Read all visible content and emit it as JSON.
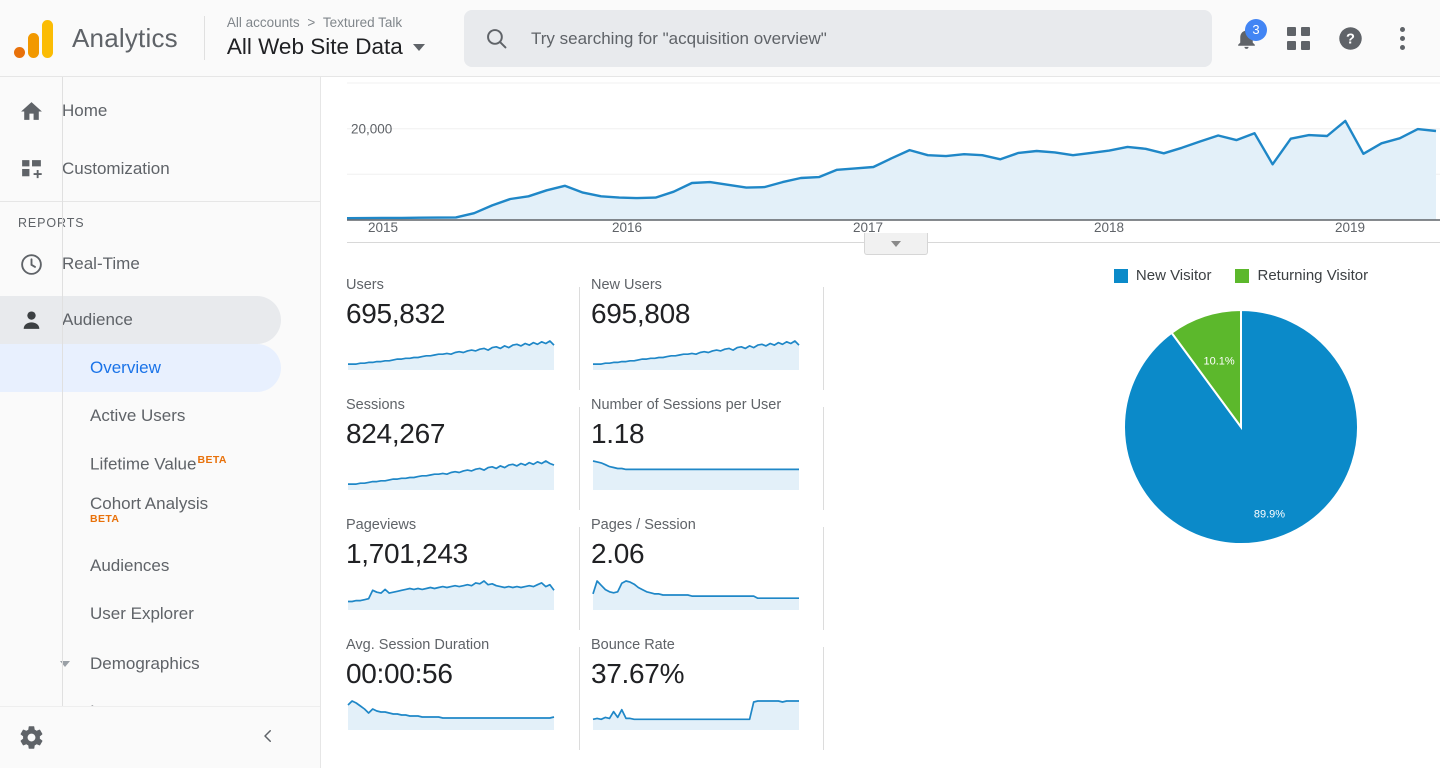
{
  "header": {
    "brand": "Analytics",
    "breadcrumb_all_accounts": "All accounts",
    "breadcrumb_sep": ">",
    "breadcrumb_account": "Textured Talk",
    "property_title": "All Web Site Data",
    "search_placeholder": "Try searching for \"acquisition overview\"",
    "search_value": "",
    "notification_count": "3",
    "icons": {
      "search": "search-icon",
      "notifications": "bell-icon",
      "apps": "apps-grid-icon",
      "help": "help-icon",
      "more": "kebab-menu-icon"
    }
  },
  "sidebar": {
    "top_items": [
      {
        "label": "Home",
        "icon": "home-icon"
      },
      {
        "label": "Customization",
        "icon": "customization-icon"
      }
    ],
    "section_label": "REPORTS",
    "reports": [
      {
        "label": "Real-Time",
        "icon": "clock-icon",
        "state": "normal"
      },
      {
        "label": "Audience",
        "icon": "person-icon",
        "state": "active-parent"
      }
    ],
    "audience_children": [
      {
        "label": "Overview",
        "state": "active-child",
        "beta": ""
      },
      {
        "label": "Active Users",
        "state": "normal",
        "beta": ""
      },
      {
        "label": "Lifetime Value",
        "state": "normal",
        "beta": "BETA",
        "beta_pos": "sup"
      },
      {
        "label": "Cohort Analysis",
        "state": "normal",
        "beta": "BETA",
        "beta_pos": "below"
      },
      {
        "label": "Audiences",
        "state": "normal",
        "beta": ""
      },
      {
        "label": "User Explorer",
        "state": "normal",
        "beta": ""
      }
    ],
    "expandables": [
      {
        "label": "Demographics"
      },
      {
        "label": "Interests"
      }
    ],
    "footer": {
      "settings_icon": "gear-icon",
      "collapse_icon": "chevron-left-icon"
    }
  },
  "main": {
    "metrics": [
      [
        {
          "label": "Users",
          "value": "695,832"
        },
        {
          "label": "New Users",
          "value": "695,808"
        }
      ],
      [
        {
          "label": "Sessions",
          "value": "824,267"
        },
        {
          "label": "Number of Sessions per User",
          "value": "1.18"
        }
      ],
      [
        {
          "label": "Pageviews",
          "value": "1,701,243"
        },
        {
          "label": "Pages / Session",
          "value": "2.06"
        }
      ],
      [
        {
          "label": "Avg. Session Duration",
          "value": "00:00:56"
        },
        {
          "label": "Bounce Rate",
          "value": "37.67%"
        }
      ]
    ]
  },
  "chart_data": [
    {
      "type": "area",
      "name": "sessions-over-time",
      "title": "",
      "xlabel": "",
      "ylabel": "",
      "grid": true,
      "ytick_labels": [
        "20,000"
      ],
      "ytick_values": [
        20000
      ],
      "ylim": [
        0,
        30000
      ],
      "xtick_labels": [
        "2015",
        "2016",
        "2017",
        "2018",
        "2019"
      ],
      "line_color": "#1f87c7",
      "fill_color": "#e3f0f9",
      "x": [
        0,
        1,
        2,
        3,
        4,
        5,
        6,
        7,
        8,
        9,
        10,
        11,
        12,
        13,
        14,
        15,
        16,
        17,
        18,
        19,
        20,
        21,
        22,
        23,
        24,
        25,
        26,
        27,
        28,
        29,
        30,
        31,
        32,
        33,
        34,
        35,
        36,
        37,
        38,
        39,
        40,
        41,
        42,
        43,
        44,
        45,
        46,
        47,
        48,
        49,
        50,
        51,
        52,
        53,
        54,
        55,
        56,
        57,
        58,
        59,
        60
      ],
      "values": [
        400,
        420,
        450,
        470,
        500,
        520,
        560,
        1500,
        3200,
        4600,
        5200,
        6500,
        7500,
        6000,
        5200,
        4900,
        4800,
        4900,
        6200,
        8100,
        8300,
        7700,
        7100,
        7200,
        8300,
        9200,
        9400,
        11000,
        11300,
        11600,
        13500,
        15300,
        14200,
        14000,
        14400,
        14200,
        13300,
        14700,
        15100,
        14800,
        14200,
        14700,
        15200,
        16000,
        15600,
        14600,
        15800,
        17200,
        18500,
        17500,
        19000,
        12200,
        17800,
        18600,
        18400,
        21700,
        14500,
        16800,
        17900,
        19900,
        19500
      ]
    },
    {
      "type": "pie",
      "name": "new-vs-returning-visitor",
      "title": "",
      "legend_position": "top",
      "labels": [
        "New Visitor",
        "Returning Visitor"
      ],
      "values": [
        89.9,
        10.1
      ],
      "value_labels": [
        "89.9%",
        "10.1%"
      ],
      "colors": [
        "#0b8ac9",
        "#5cb82c"
      ]
    },
    {
      "type": "line",
      "name": "sparkline-users",
      "values": [
        6,
        6,
        6,
        7,
        7,
        8,
        8,
        9,
        9,
        10,
        10,
        11,
        12,
        12,
        13,
        13,
        14,
        14,
        15,
        16,
        16,
        17,
        18,
        18,
        19,
        18,
        20,
        21,
        20,
        22,
        23,
        22,
        24,
        25,
        23,
        26,
        27,
        25,
        28,
        26,
        29,
        30,
        28,
        31,
        29,
        32,
        30,
        33,
        31,
        34,
        29
      ]
    },
    {
      "type": "line",
      "name": "sparkline-new-users",
      "values": [
        6,
        6,
        6,
        7,
        7,
        8,
        8,
        9,
        9,
        10,
        10,
        11,
        12,
        12,
        13,
        13,
        14,
        14,
        15,
        16,
        16,
        17,
        18,
        18,
        19,
        18,
        20,
        21,
        20,
        22,
        23,
        22,
        24,
        25,
        23,
        26,
        27,
        25,
        28,
        26,
        29,
        30,
        28,
        31,
        29,
        32,
        30,
        33,
        31,
        34,
        29
      ]
    },
    {
      "type": "line",
      "name": "sparkline-sessions",
      "values": [
        6,
        6,
        6,
        7,
        7,
        8,
        9,
        9,
        10,
        10,
        11,
        12,
        12,
        13,
        13,
        14,
        14,
        15,
        16,
        16,
        17,
        18,
        18,
        19,
        18,
        20,
        21,
        20,
        22,
        23,
        22,
        24,
        25,
        23,
        26,
        27,
        25,
        28,
        26,
        29,
        30,
        28,
        31,
        29,
        32,
        30,
        33,
        31,
        34,
        31,
        29
      ]
    },
    {
      "type": "line",
      "name": "sparkline-sessions-per-user",
      "values": [
        30,
        29,
        28,
        26,
        24,
        23,
        22,
        22,
        21,
        21,
        21,
        21,
        21,
        21,
        21,
        21,
        21,
        21,
        21,
        21,
        21,
        21,
        21,
        21,
        21,
        21,
        21,
        21,
        21,
        21,
        21,
        21,
        21,
        21,
        21,
        21,
        21,
        21,
        21,
        21,
        21,
        21,
        21,
        21,
        21,
        21,
        21,
        21,
        21,
        21,
        21
      ]
    },
    {
      "type": "line",
      "name": "sparkline-pageviews",
      "values": [
        8,
        8,
        9,
        9,
        10,
        11,
        20,
        18,
        17,
        21,
        17,
        18,
        19,
        20,
        21,
        22,
        21,
        22,
        21,
        22,
        23,
        22,
        23,
        24,
        23,
        24,
        25,
        24,
        25,
        26,
        25,
        28,
        27,
        30,
        26,
        27,
        25,
        24,
        23,
        24,
        23,
        24,
        23,
        24,
        25,
        24,
        26,
        28,
        24,
        26,
        20
      ]
    },
    {
      "type": "line",
      "name": "sparkline-pages-per-session",
      "values": [
        14,
        26,
        22,
        18,
        16,
        15,
        16,
        24,
        26,
        25,
        23,
        20,
        18,
        16,
        15,
        14,
        14,
        13,
        13,
        13,
        13,
        13,
        13,
        13,
        12,
        12,
        12,
        12,
        12,
        12,
        12,
        12,
        12,
        12,
        12,
        12,
        12,
        12,
        12,
        12,
        10,
        10,
        10,
        10,
        10,
        10,
        10,
        10,
        10,
        10,
        10
      ]
    },
    {
      "type": "line",
      "name": "sparkline-avg-session-duration",
      "values": [
        24,
        28,
        26,
        23,
        20,
        16,
        20,
        18,
        17,
        17,
        16,
        15,
        15,
        14,
        14,
        13,
        13,
        13,
        12,
        12,
        12,
        12,
        12,
        11,
        11,
        11,
        11,
        11,
        11,
        11,
        11,
        11,
        11,
        11,
        11,
        11,
        11,
        11,
        11,
        11,
        11,
        11,
        11,
        11,
        11,
        11,
        11,
        11,
        11,
        11,
        12
      ]
    },
    {
      "type": "line",
      "name": "sparkline-bounce-rate",
      "values": [
        10,
        11,
        10,
        12,
        11,
        18,
        12,
        20,
        11,
        11,
        10,
        10,
        10,
        10,
        10,
        10,
        10,
        10,
        10,
        10,
        10,
        10,
        10,
        10,
        10,
        10,
        10,
        10,
        10,
        10,
        10,
        10,
        10,
        10,
        10,
        10,
        10,
        10,
        10,
        28,
        29,
        29,
        29,
        29,
        29,
        29,
        28,
        29,
        29,
        29,
        29
      ]
    }
  ]
}
